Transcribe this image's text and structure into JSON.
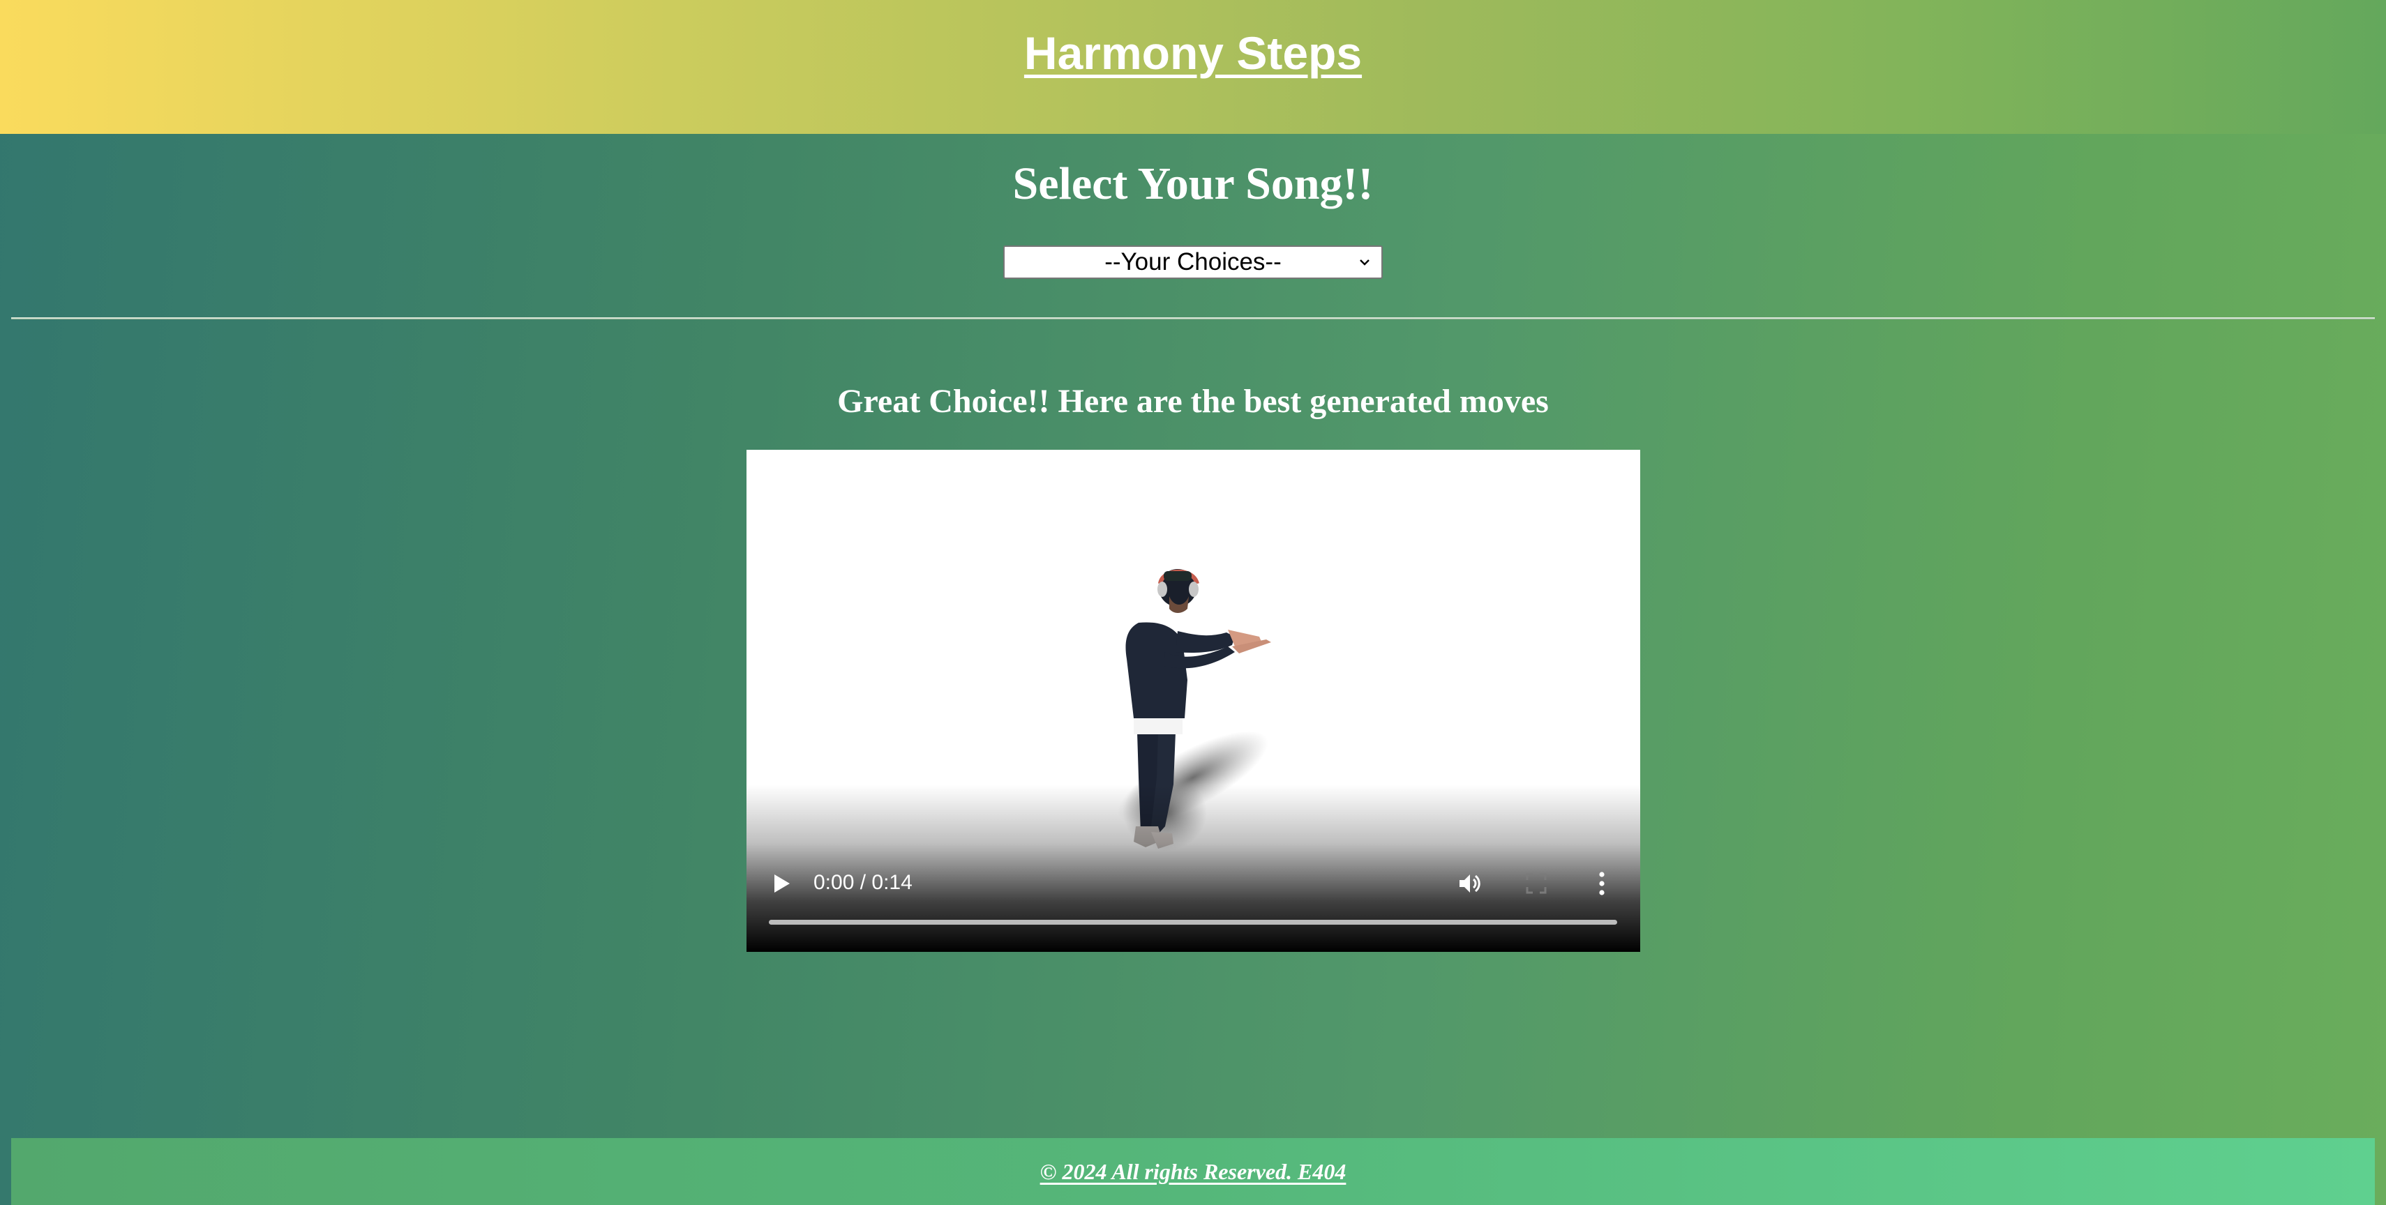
{
  "header": {
    "title": "Harmony Steps"
  },
  "song_section": {
    "heading": "Select Your Song!!",
    "select": {
      "selected_value": "--Your Choices--"
    }
  },
  "result_section": {
    "heading": "Great Choice!! Here are the best generated moves",
    "video": {
      "time_display": "0:00 / 0:14",
      "progress": 0,
      "controls": {
        "play_icon": "play-icon",
        "volume_icon": "volume-icon",
        "fullscreen_icon": "fullscreen-icon",
        "more_icon": "more-vertical-icon"
      }
    }
  },
  "footer": {
    "copyright": "© 2024 All rights Reserved. E404"
  },
  "colors": {
    "header_gradient_start": "#fadb5d",
    "header_gradient_end": "#64a85c",
    "body_gradient_start": "#33776e",
    "body_gradient_end": "#6aad5c",
    "footer_gradient_end": "#5fd08f",
    "text": "#ffffff"
  }
}
